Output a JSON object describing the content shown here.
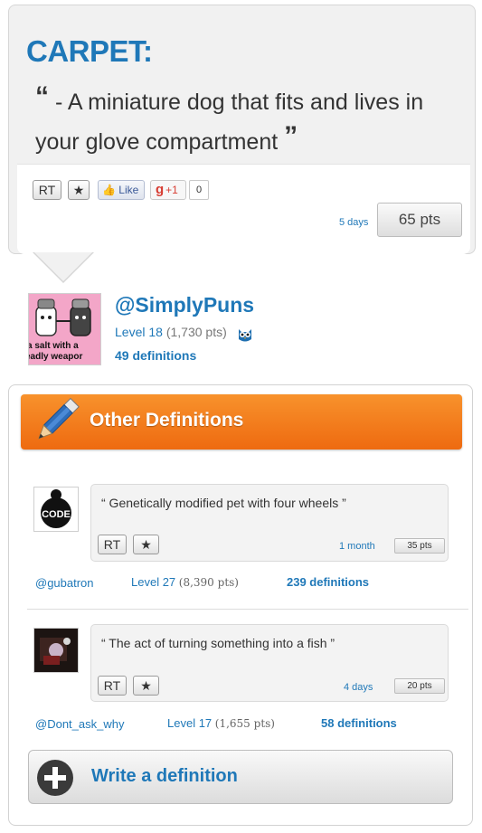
{
  "definition": {
    "word": "CARPET:",
    "open_quote": "“",
    "close_quote": "”",
    "text": " - A miniature dog that fits and lives in your glove compartment ",
    "rt_label": "RT",
    "fav_label": "★",
    "like_label": "Like",
    "gplus_g": "g",
    "gplus_label": "+1",
    "gplus_count": "0",
    "time": "5 days",
    "points": "65 pts"
  },
  "author": {
    "handle": "@SimplyPuns",
    "level": "Level 18",
    "points": "(1,730 pts)",
    "definitions": "49 definitions",
    "avatar_caption_1": "a salt with a",
    "avatar_caption_2": "eadly weapor"
  },
  "other": {
    "title": "Other Definitions",
    "entries": [
      {
        "text": "“ Genetically modified pet with four wheels ”",
        "rt_label": "RT",
        "fav_label": "★",
        "time": "1 month",
        "points": "35 pts",
        "handle": "@gubatron",
        "level": "Level 27",
        "level_points": "(8,390 pts)",
        "definitions": "239 definitions",
        "avatar_text": "CODE"
      },
      {
        "text": "“ The act of turning something into a fish ”",
        "rt_label": "RT",
        "fav_label": "★",
        "time": "4 days",
        "points": "20 pts",
        "handle": "@Dont_ask_why",
        "level": "Level 17",
        "level_points": "(1,655 pts)",
        "definitions": "58 definitions"
      }
    ],
    "write_label": "Write a definition"
  },
  "colors": {
    "link_blue": "#1f78b8",
    "orange": "#f07a1a"
  }
}
